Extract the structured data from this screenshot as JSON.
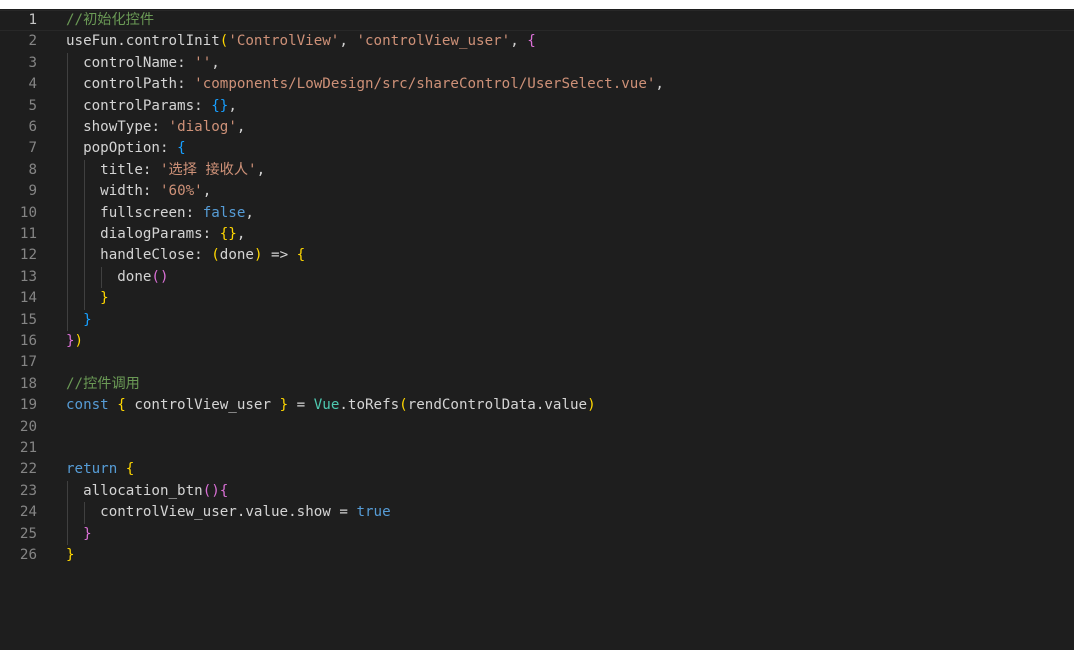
{
  "colors": {
    "background": "#1e1e1e",
    "line_number": "#858585",
    "line_number_active": "#c6c6c6",
    "default": "#d4d4d4",
    "comment": "#6a9955",
    "string": "#ce9178",
    "keyword": "#569cd6",
    "function": "#dcdcaa",
    "property": "#9cdcfe",
    "variable": "#9cdcfe",
    "class": "#4ec9b0",
    "bracket1": "#ffd700",
    "bracket2": "#da70d6",
    "bracket3": "#179fff"
  },
  "editor": {
    "active_line": 1,
    "lines": [
      {
        "n": "1",
        "indent": "",
        "tokens": [
          {
            "t": "//初始化控件",
            "c": "comment"
          }
        ]
      },
      {
        "n": "2",
        "indent": "",
        "tokens": [
          {
            "t": "useFun",
            "c": "default"
          },
          {
            "t": ".",
            "c": "default"
          },
          {
            "t": "controlInit",
            "c": "default"
          },
          {
            "t": "(",
            "c": "bracket1"
          },
          {
            "t": "'ControlView'",
            "c": "string"
          },
          {
            "t": ", ",
            "c": "default"
          },
          {
            "t": "'controlView_user'",
            "c": "string"
          },
          {
            "t": ", ",
            "c": "default"
          },
          {
            "t": "{",
            "c": "bracket2"
          }
        ]
      },
      {
        "n": "3",
        "indent": "  ",
        "tokens": [
          {
            "t": "controlName",
            "c": "default"
          },
          {
            "t": ": ",
            "c": "default"
          },
          {
            "t": "''",
            "c": "string"
          },
          {
            "t": ",",
            "c": "default"
          }
        ]
      },
      {
        "n": "4",
        "indent": "  ",
        "tokens": [
          {
            "t": "controlPath",
            "c": "default"
          },
          {
            "t": ": ",
            "c": "default"
          },
          {
            "t": "'components/LowDesign/src/shareControl/UserSelect.vue'",
            "c": "string"
          },
          {
            "t": ",",
            "c": "default"
          }
        ]
      },
      {
        "n": "5",
        "indent": "  ",
        "tokens": [
          {
            "t": "controlParams",
            "c": "default"
          },
          {
            "t": ": ",
            "c": "default"
          },
          {
            "t": "{}",
            "c": "bracket3"
          },
          {
            "t": ",",
            "c": "default"
          }
        ]
      },
      {
        "n": "6",
        "indent": "  ",
        "tokens": [
          {
            "t": "showType",
            "c": "default"
          },
          {
            "t": ": ",
            "c": "default"
          },
          {
            "t": "'dialog'",
            "c": "string"
          },
          {
            "t": ",",
            "c": "default"
          }
        ]
      },
      {
        "n": "7",
        "indent": "  ",
        "tokens": [
          {
            "t": "popOption",
            "c": "default"
          },
          {
            "t": ": ",
            "c": "default"
          },
          {
            "t": "{",
            "c": "bracket3"
          }
        ]
      },
      {
        "n": "8",
        "indent": "    ",
        "tokens": [
          {
            "t": "title",
            "c": "default"
          },
          {
            "t": ": ",
            "c": "default"
          },
          {
            "t": "'选择 接收人'",
            "c": "string"
          },
          {
            "t": ",",
            "c": "default"
          }
        ]
      },
      {
        "n": "9",
        "indent": "    ",
        "tokens": [
          {
            "t": "width",
            "c": "default"
          },
          {
            "t": ": ",
            "c": "default"
          },
          {
            "t": "'60%'",
            "c": "string"
          },
          {
            "t": ",",
            "c": "default"
          }
        ]
      },
      {
        "n": "10",
        "indent": "    ",
        "tokens": [
          {
            "t": "fullscreen",
            "c": "default"
          },
          {
            "t": ": ",
            "c": "default"
          },
          {
            "t": "false",
            "c": "keyword"
          },
          {
            "t": ",",
            "c": "default"
          }
        ]
      },
      {
        "n": "11",
        "indent": "    ",
        "tokens": [
          {
            "t": "dialogParams",
            "c": "default"
          },
          {
            "t": ": ",
            "c": "default"
          },
          {
            "t": "{}",
            "c": "bracket1"
          },
          {
            "t": ",",
            "c": "default"
          }
        ]
      },
      {
        "n": "12",
        "indent": "    ",
        "tokens": [
          {
            "t": "handleClose",
            "c": "default"
          },
          {
            "t": ": ",
            "c": "default"
          },
          {
            "t": "(",
            "c": "bracket1"
          },
          {
            "t": "done",
            "c": "default"
          },
          {
            "t": ")",
            "c": "bracket1"
          },
          {
            "t": " => ",
            "c": "default"
          },
          {
            "t": "{",
            "c": "bracket1"
          }
        ]
      },
      {
        "n": "13",
        "indent": "      ",
        "tokens": [
          {
            "t": "done",
            "c": "default"
          },
          {
            "t": "()",
            "c": "bracket2"
          }
        ]
      },
      {
        "n": "14",
        "indent": "    ",
        "tokens": [
          {
            "t": "}",
            "c": "bracket1"
          }
        ]
      },
      {
        "n": "15",
        "indent": "  ",
        "tokens": [
          {
            "t": "}",
            "c": "bracket3"
          }
        ]
      },
      {
        "n": "16",
        "indent": "",
        "tokens": [
          {
            "t": "}",
            "c": "bracket2"
          },
          {
            "t": ")",
            "c": "bracket1"
          }
        ]
      },
      {
        "n": "17",
        "indent": "",
        "tokens": []
      },
      {
        "n": "18",
        "indent": "",
        "tokens": [
          {
            "t": "//控件调用",
            "c": "comment"
          }
        ]
      },
      {
        "n": "19",
        "indent": "",
        "tokens": [
          {
            "t": "const",
            "c": "keyword"
          },
          {
            "t": " ",
            "c": "default"
          },
          {
            "t": "{",
            "c": "bracket1"
          },
          {
            "t": " controlView_user ",
            "c": "default"
          },
          {
            "t": "}",
            "c": "bracket1"
          },
          {
            "t": " = ",
            "c": "default"
          },
          {
            "t": "Vue",
            "c": "class"
          },
          {
            "t": ".",
            "c": "default"
          },
          {
            "t": "toRefs",
            "c": "default"
          },
          {
            "t": "(",
            "c": "bracket1"
          },
          {
            "t": "rendControlData",
            "c": "default"
          },
          {
            "t": ".",
            "c": "default"
          },
          {
            "t": "value",
            "c": "default"
          },
          {
            "t": ")",
            "c": "bracket1"
          }
        ]
      },
      {
        "n": "20",
        "indent": "",
        "tokens": []
      },
      {
        "n": "21",
        "indent": "",
        "tokens": []
      },
      {
        "n": "22",
        "indent": "",
        "tokens": [
          {
            "t": "return",
            "c": "keyword"
          },
          {
            "t": " ",
            "c": "default"
          },
          {
            "t": "{",
            "c": "bracket1"
          }
        ]
      },
      {
        "n": "23",
        "indent": "  ",
        "tokens": [
          {
            "t": "allocation_btn",
            "c": "default"
          },
          {
            "t": "()",
            "c": "bracket2"
          },
          {
            "t": "{",
            "c": "bracket2"
          }
        ]
      },
      {
        "n": "24",
        "indent": "    ",
        "tokens": [
          {
            "t": "controlView_user",
            "c": "default"
          },
          {
            "t": ".",
            "c": "default"
          },
          {
            "t": "value",
            "c": "default"
          },
          {
            "t": ".",
            "c": "default"
          },
          {
            "t": "show",
            "c": "default"
          },
          {
            "t": " = ",
            "c": "default"
          },
          {
            "t": "true",
            "c": "keyword"
          }
        ]
      },
      {
        "n": "25",
        "indent": "  ",
        "tokens": [
          {
            "t": "}",
            "c": "bracket2"
          }
        ]
      },
      {
        "n": "26",
        "indent": "",
        "tokens": [
          {
            "t": "}",
            "c": "bracket1"
          }
        ]
      }
    ]
  }
}
